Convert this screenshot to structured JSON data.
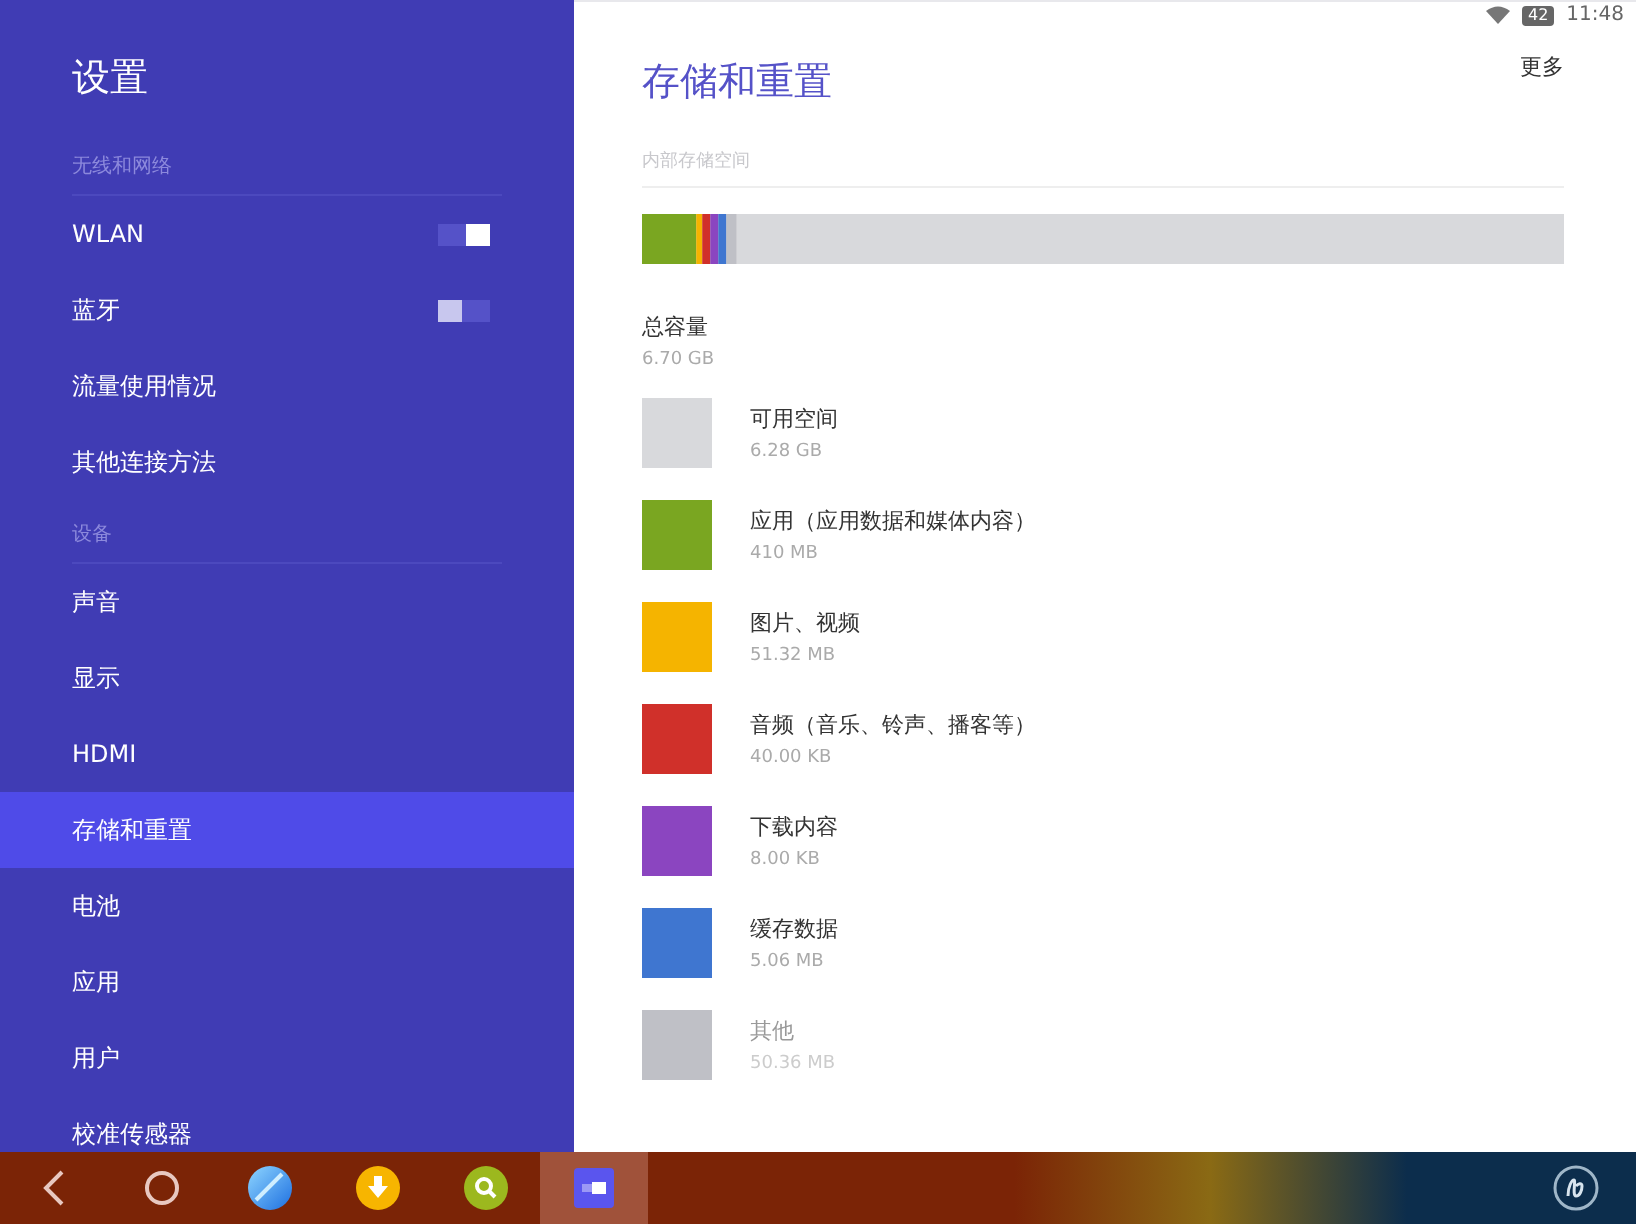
{
  "sidebar": {
    "title": "设置",
    "sections": [
      {
        "header": "无线和网络",
        "items": [
          {
            "label": "WLAN",
            "kind": "switch",
            "on": true,
            "selected": false
          },
          {
            "label": "蓝牙",
            "kind": "switch",
            "on": false,
            "selected": false
          },
          {
            "label": "流量使用情况",
            "kind": "link",
            "selected": false
          },
          {
            "label": "其他连接方法",
            "kind": "link",
            "selected": false
          }
        ]
      },
      {
        "header": "设备",
        "items": [
          {
            "label": "声音",
            "kind": "link",
            "selected": false
          },
          {
            "label": "显示",
            "kind": "link",
            "selected": false
          },
          {
            "label": "HDMI",
            "kind": "link",
            "selected": false
          },
          {
            "label": "存储和重置",
            "kind": "link",
            "selected": true
          },
          {
            "label": "电池",
            "kind": "link",
            "selected": false
          },
          {
            "label": "应用",
            "kind": "link",
            "selected": false
          },
          {
            "label": "用户",
            "kind": "link",
            "selected": false
          },
          {
            "label": "校准传感器",
            "kind": "link",
            "selected": false
          }
        ]
      }
    ]
  },
  "status_bar": {
    "battery": "42",
    "time": "11:48"
  },
  "page": {
    "title": "存储和重置",
    "menu": "更多",
    "section": "内部存储空间",
    "total": {
      "label": "总容量",
      "value": "6.70 GB"
    },
    "categories": [
      {
        "name": "可用空间",
        "size": "6.28 GB",
        "color": "#d8d9dc",
        "disabled": false
      },
      {
        "name": "应用（应用数据和媒体内容）",
        "size": "410 MB",
        "color": "#7aa621",
        "disabled": false
      },
      {
        "name": "图片、视频",
        "size": "51.32 MB",
        "color": "#f5b400",
        "disabled": false
      },
      {
        "name": "音频（音乐、铃声、播客等）",
        "size": "40.00 KB",
        "color": "#d0302a",
        "disabled": false
      },
      {
        "name": "下载内容",
        "size": "8.00 KB",
        "color": "#8b45c0",
        "disabled": false
      },
      {
        "name": "缓存数据",
        "size": "5.06 MB",
        "color": "#3f76d0",
        "disabled": false
      },
      {
        "name": "其他",
        "size": "50.36 MB",
        "color": "#bfc0c6",
        "disabled": true
      }
    ]
  },
  "taskbar": {
    "apps": [
      {
        "kind": "back",
        "selected": false
      },
      {
        "kind": "home",
        "selected": false
      },
      {
        "kind": "browser",
        "selected": false
      },
      {
        "kind": "download",
        "selected": false
      },
      {
        "kind": "search",
        "selected": false
      },
      {
        "kind": "settings",
        "selected": true
      }
    ]
  }
}
